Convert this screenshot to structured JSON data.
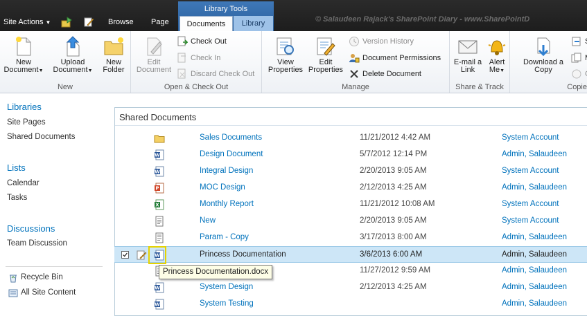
{
  "topbar": {
    "site_actions": "Site Actions",
    "tabs": {
      "browse": "Browse",
      "page": "Page",
      "documents": "Documents",
      "library": "Library"
    },
    "library_tools": "Library Tools",
    "watermark": "© Salaudeen Rajack's SharePoint Diary - www.SharePointD"
  },
  "ribbon": {
    "new_group": {
      "label": "New",
      "new_document": [
        "New",
        "Document"
      ],
      "upload_document": [
        "Upload",
        "Document"
      ],
      "new_folder": [
        "New",
        "Folder"
      ]
    },
    "open_group": {
      "label": "Open & Check Out",
      "edit_document": [
        "Edit",
        "Document"
      ],
      "check_out": "Check Out",
      "check_in": "Check In",
      "discard_check_out": "Discard Check Out"
    },
    "manage_group": {
      "label": "Manage",
      "view_properties": [
        "View",
        "Properties"
      ],
      "edit_properties": [
        "Edit",
        "Properties"
      ],
      "version_history": "Version History",
      "document_permissions": "Document Permissions",
      "delete_document": "Delete Document"
    },
    "share_group": {
      "label": "Share & Track",
      "email_link": [
        "E-mail a",
        "Link"
      ],
      "alert_me": [
        "Alert",
        "Me"
      ]
    },
    "copies_group": {
      "label": "Copie",
      "download_copy": [
        "Download a",
        "Copy"
      ],
      "s1": "S",
      "s2": "M",
      "s3": "G"
    }
  },
  "leftnav": {
    "libraries": "Libraries",
    "site_pages": "Site Pages",
    "shared_documents": "Shared Documents",
    "lists": "Lists",
    "calendar": "Calendar",
    "tasks": "Tasks",
    "discussions": "Discussions",
    "team_discussion": "Team Discussion",
    "recycle_bin": "Recycle Bin",
    "all_site_content": "All Site Content"
  },
  "webpart": {
    "title": "Shared Documents",
    "rows": [
      {
        "icon": "folder-icon",
        "name": "Sales Documents",
        "modified": "11/21/2012 4:42 AM",
        "by": "System Account"
      },
      {
        "icon": "word-icon",
        "name": "Design Document",
        "modified": "5/7/2012 12:14 PM",
        "by": "Admin, Salaudeen"
      },
      {
        "icon": "word-icon",
        "name": "Integral Design",
        "modified": "2/20/2013 9:05 AM",
        "by": "System Account"
      },
      {
        "icon": "powerpoint-icon",
        "name": "MOC Design",
        "modified": "2/12/2013 4:25 AM",
        "by": "Admin, Salaudeen"
      },
      {
        "icon": "excel-icon",
        "name": "Monthly Report",
        "modified": "11/21/2012 10:08 AM",
        "by": "System Account"
      },
      {
        "icon": "text-file-icon",
        "name": "New",
        "modified": "2/20/2013 9:05 AM",
        "by": "System Account"
      },
      {
        "icon": "text-file-icon",
        "name": "Param - Copy",
        "modified": "3/17/2013 8:00 AM",
        "by": "Admin, Salaudeen"
      },
      {
        "icon": "word-icon",
        "name": "Princess Documentation",
        "modified": "3/6/2013 6:00 AM",
        "by": "Admin, Salaudeen"
      },
      {
        "icon": "text-file-icon",
        "name": "",
        "modified": "11/27/2012 9:59 AM",
        "by": "Admin, Salaudeen"
      },
      {
        "icon": "word-icon",
        "name": "System Design",
        "modified": "2/12/2013 4:25 AM",
        "by": "Admin, Salaudeen"
      },
      {
        "icon": "word-icon",
        "name": "System Testing",
        "modified": "",
        "by": "Admin, Salaudeen"
      }
    ],
    "tooltip": "Princess Documentation.docx"
  }
}
